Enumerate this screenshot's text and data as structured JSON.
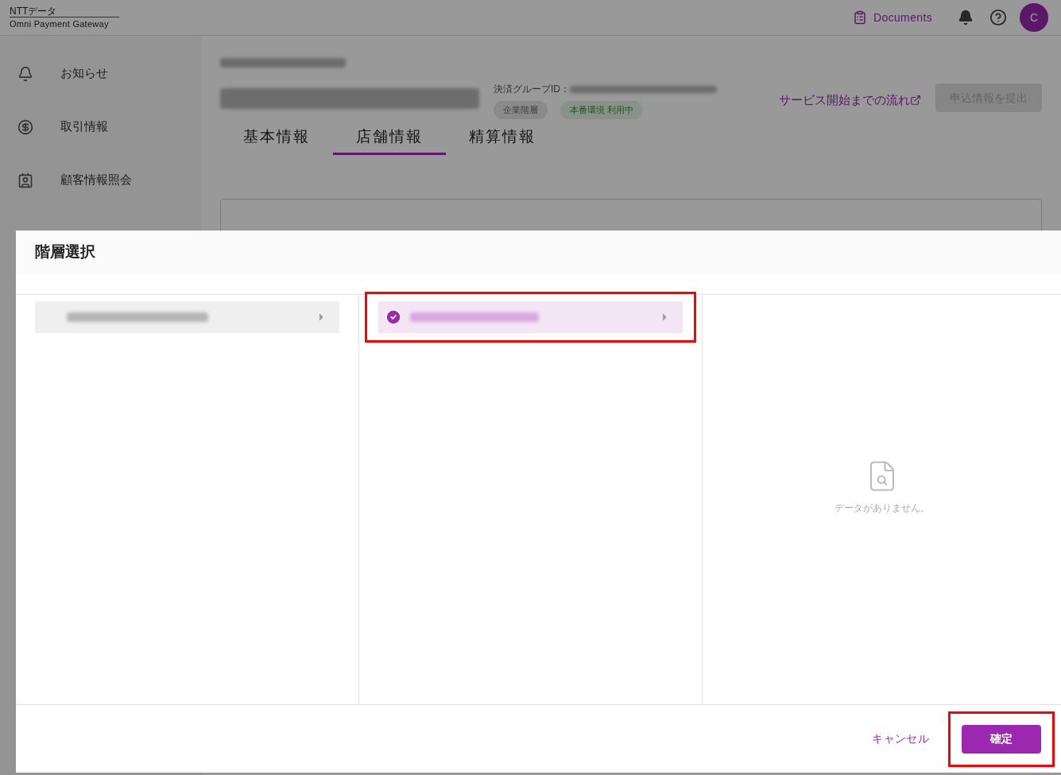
{
  "header": {
    "brand_top": "NTTデータ",
    "brand_bottom": "Omni Payment Gateway",
    "documents_link": "Documents",
    "avatar_initial": "C"
  },
  "sidebar": {
    "items": [
      {
        "label": "お知らせ",
        "kind": "bell"
      },
      {
        "label": "取引情報",
        "kind": "dollar"
      },
      {
        "label": "顧客情報照会",
        "kind": "contacts"
      }
    ]
  },
  "merchant": {
    "group_id_label": "決済グループID：",
    "tags": [
      {
        "label": "企業階層",
        "kind": "neutral"
      },
      {
        "label": "本番環境 利用中",
        "kind": "success"
      }
    ],
    "flow_link": "サービス開始までの流れ",
    "submit_button": {
      "label": "申込情報を提出",
      "disabled": true
    }
  },
  "tabs": [
    {
      "label": "基本情報",
      "selected": false
    },
    {
      "label": "店舗情報",
      "selected": true
    },
    {
      "label": "精算情報",
      "selected": false
    }
  ],
  "dialog": {
    "title": "階層選択",
    "columns": [
      {
        "items": [
          {
            "selected": false,
            "highlighted": false
          }
        ]
      },
      {
        "items": [
          {
            "selected": true,
            "highlighted": true
          }
        ]
      },
      {
        "empty_message": "データがありません。"
      }
    ],
    "cancel": "キャンセル",
    "confirm": {
      "label": "確定",
      "highlighted": true
    }
  }
}
